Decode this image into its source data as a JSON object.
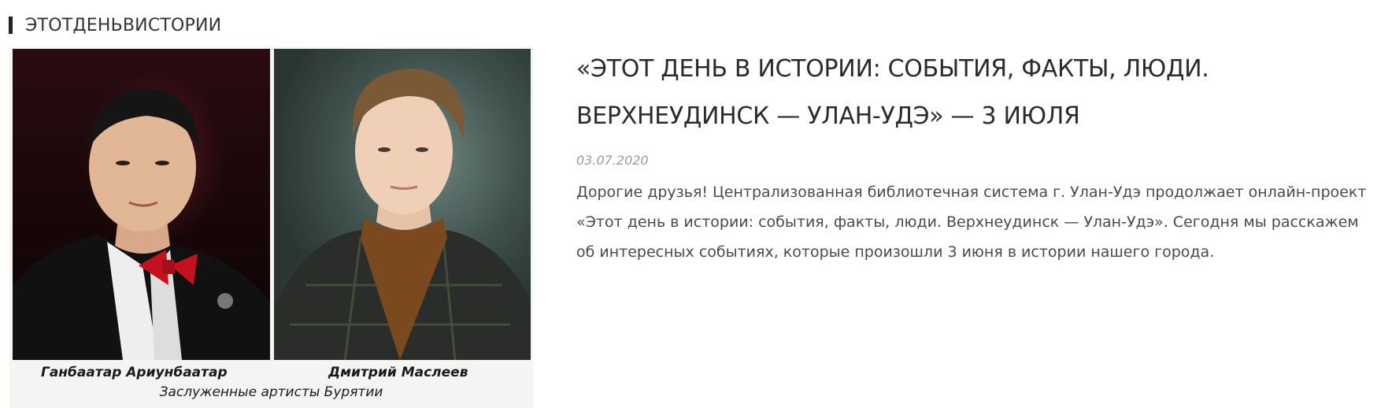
{
  "category": {
    "label": "ЭТОТДЕНЬВИСТОРИИ"
  },
  "photo": {
    "person_left": "Ганбаатар Ариунбаатар",
    "person_right": "Дмитрий Маслеев",
    "subtitle": "Заслуженные артисты Бурятии"
  },
  "article": {
    "title": "«ЭТОТ ДЕНЬ В ИСТОРИИ: СОБЫТИЯ, ФАКТЫ, ЛЮДИ. ВЕРХНЕУДИНСК — УЛАН-УДЭ» — 3 ИЮЛЯ",
    "date": "03.07.2020",
    "excerpt": "Дорогие друзья! Централизованная библиотечная система г. Улан-Удэ продолжает онлайн-проект «Этот день в истории: события, факты, люди. Верхнеудинск — Улан-Удэ». Сегодня мы расскажем об интересных событиях, которые произошли 3 июня в истории нашего города."
  },
  "colors": {
    "title": "#2b2b2b",
    "date": "#9a9a9a",
    "text": "#4a4a4a",
    "bow_tie": "#c3121d"
  }
}
